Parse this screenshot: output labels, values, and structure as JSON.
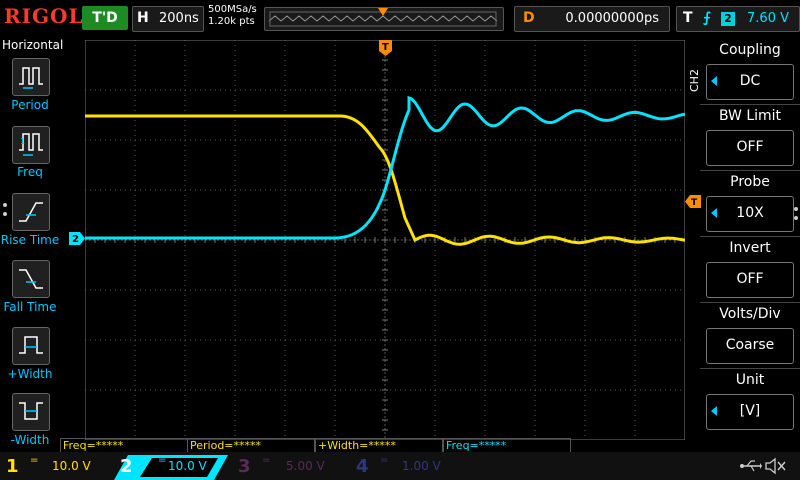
{
  "brand": "RIGOL",
  "run_state": "T'D",
  "horizontal": {
    "label": "H",
    "timebase": "200ns",
    "sample_rate": "500MSa/s",
    "mem_depth": "1.20k pts"
  },
  "trigger_position": {
    "label": "D",
    "value": "0.00000000ps"
  },
  "trigger": {
    "label": "T",
    "source": "2",
    "level": "7.60 V"
  },
  "left_menu": {
    "title": "Horizontal",
    "items": [
      {
        "label": "Period"
      },
      {
        "label": "Freq"
      },
      {
        "label": "Rise Time"
      },
      {
        "label": "Fall Time"
      },
      {
        "label": "+Width"
      },
      {
        "label": "-Width"
      }
    ]
  },
  "right_menu": {
    "channel_label": "CH2",
    "items": [
      {
        "title": "Coupling",
        "value": "DC"
      },
      {
        "title": "BW Limit",
        "value": "OFF"
      },
      {
        "title": "Probe",
        "value": "10X"
      },
      {
        "title": "Invert",
        "value": "OFF"
      },
      {
        "title": "Volts/Div",
        "value": "Coarse"
      },
      {
        "title": "Unit",
        "value": "[V]"
      }
    ]
  },
  "measurements": [
    {
      "label": "Freq=*****",
      "color": "#ffe200"
    },
    {
      "label": "Period=*****",
      "color": "#ffe200"
    },
    {
      "label": "+Width=*****",
      "color": "#ffe200"
    },
    {
      "label": "Freq=*****",
      "color": "#00e5ff"
    }
  ],
  "channels": [
    {
      "num": "1",
      "coupling": "=",
      "scale": "10.0 V",
      "color": "#ffe200",
      "active": true
    },
    {
      "num": "2",
      "coupling": "=",
      "scale": "10.0 V",
      "color": "#00e5ff",
      "active": true
    },
    {
      "num": "3",
      "coupling": "=",
      "scale": "5.00 V",
      "color": "#c040c0",
      "active": false
    },
    {
      "num": "4",
      "coupling": "=",
      "scale": "1.00 V",
      "color": "#4060ff",
      "active": false
    }
  ],
  "markers": {
    "ch2_ground": "2",
    "trigger_level": "T",
    "trigger_time": "T"
  },
  "colors": {
    "ch1": "#ffe200",
    "ch2": "#00e5ff",
    "trigger": "#ff8c00",
    "accent": "#00c8ff"
  },
  "status_icons": [
    "usb-icon",
    "speaker-mute-icon"
  ]
}
